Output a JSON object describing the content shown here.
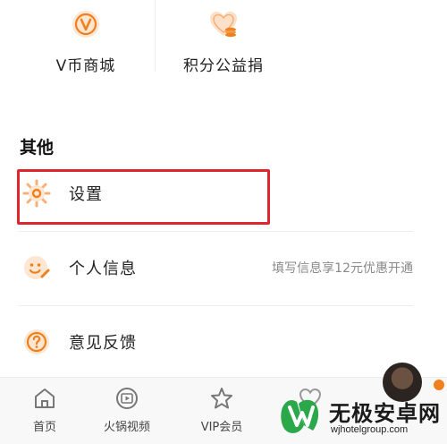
{
  "tiles": [
    {
      "label": "V币商城",
      "icon": "v-coin-icon"
    },
    {
      "label": "积分公益捐",
      "icon": "heart-coins-icon"
    }
  ],
  "section": {
    "title": "其他",
    "items": [
      {
        "label": "设置",
        "icon": "gear-icon",
        "hint": ""
      },
      {
        "label": "个人信息",
        "icon": "smile-edit-icon",
        "hint": "填写信息享12元优惠开通"
      },
      {
        "label": "意见反馈",
        "icon": "question-icon",
        "hint": ""
      }
    ]
  },
  "tabbar": {
    "items": [
      {
        "label": "首页",
        "icon": "home-icon"
      },
      {
        "label": "火锅视频",
        "icon": "play-icon"
      },
      {
        "label": "VIP会员",
        "icon": "vip-star-icon"
      },
      {
        "label": "",
        "icon": "heart-icon"
      }
    ]
  },
  "watermark": {
    "title": "无极安卓网",
    "url": "wjhotelgroup.com"
  },
  "colors": {
    "accent": "#f0801e",
    "highlight": "#e0262d",
    "text": "#222222",
    "hint": "#8a8a8a",
    "watermark_green": "#2aa84a"
  }
}
